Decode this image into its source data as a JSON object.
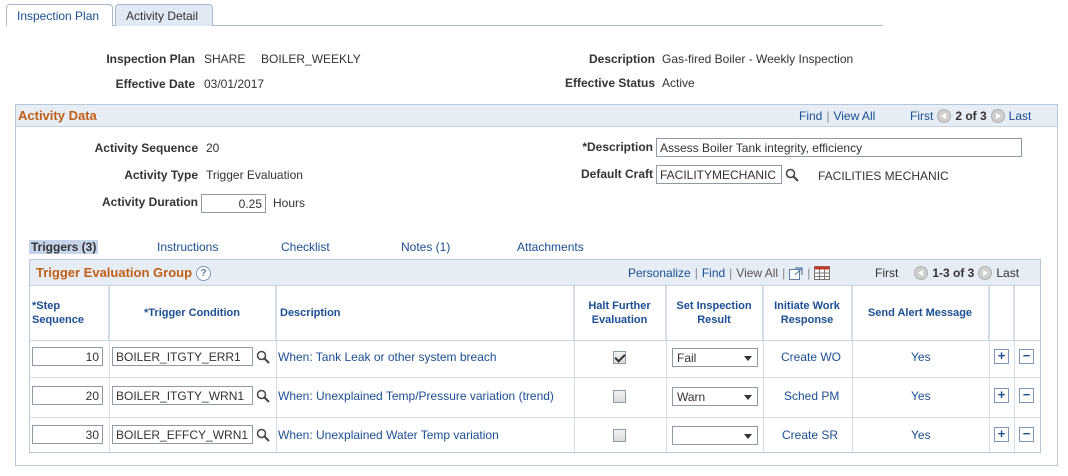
{
  "tabs": [
    {
      "label": "Inspection Plan"
    },
    {
      "label": "Activity Detail"
    }
  ],
  "header": {
    "plan_label": "Inspection Plan",
    "plan_setid": "SHARE",
    "plan_id": "BOILER_WEEKLY",
    "eff_date_label": "Effective Date",
    "eff_date": "03/01/2017",
    "desc_label": "Description",
    "desc": "Gas-fired Boiler - Weekly Inspection",
    "eff_status_label": "Effective Status",
    "eff_status": "Active"
  },
  "activity": {
    "title": "Activity Data",
    "find": "Find",
    "view_all": "View All",
    "first": "First",
    "count": "2 of 3",
    "last": "Last",
    "seq_label": "Activity Sequence",
    "seq": "20",
    "type_label": "Activity Type",
    "type": "Trigger Evaluation",
    "duration_label": "Activity Duration",
    "duration": "0.25",
    "duration_unit": "Hours",
    "desc_label": "*Description",
    "desc": "Assess Boiler Tank integrity, efficiency",
    "craft_label": "Default Craft",
    "craft": "FACILITYMECHANIC",
    "craft_desc": "FACILITIES MECHANIC"
  },
  "subtabs": [
    {
      "label": "Triggers (3)"
    },
    {
      "label": "Instructions"
    },
    {
      "label": "Checklist"
    },
    {
      "label": "Notes (1)"
    },
    {
      "label": "Attachments"
    }
  ],
  "grid": {
    "title": "Trigger Evaluation Group",
    "personalize": "Personalize",
    "find": "Find",
    "view_all": "View All",
    "first": "First",
    "count": "1-3 of 3",
    "last": "Last",
    "columns": {
      "step_seq": "*Step Sequence",
      "condition": "*Trigger Condition",
      "description": "Description",
      "halt": "Halt Further Evaluation",
      "result": "Set Inspection Result",
      "work": "Initiate Work Response",
      "alert": "Send Alert Message"
    },
    "rows": [
      {
        "seq": "10",
        "condition": "BOILER_ITGTY_ERR1",
        "description": "When: Tank Leak or other system breach",
        "halt": true,
        "result": "Fail",
        "work": "Create WO",
        "alert": "Yes"
      },
      {
        "seq": "20",
        "condition": "BOILER_ITGTY_WRN1",
        "description": "When: Unexplained Temp/Pressure variation (trend)",
        "halt": false,
        "result": "Warn",
        "work": "Sched PM",
        "alert": "Yes"
      },
      {
        "seq": "30",
        "condition": "BOILER_EFFCY_WRN1",
        "description": "When: Unexplained Water Temp variation",
        "halt": false,
        "result": "",
        "work": "Create SR",
        "alert": "Yes"
      }
    ]
  }
}
